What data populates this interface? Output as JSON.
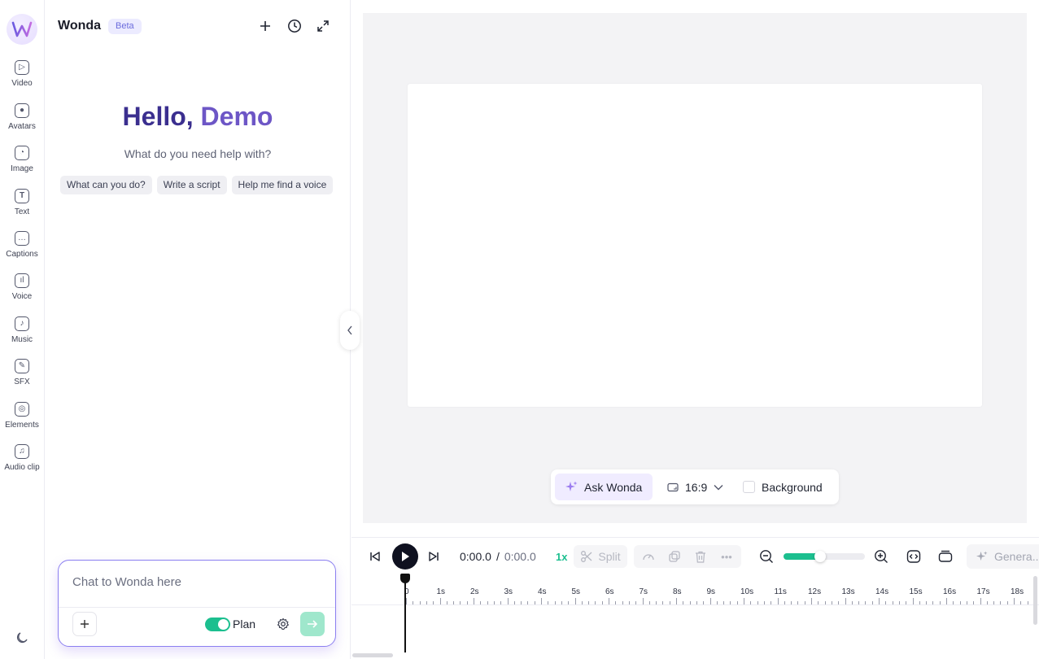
{
  "rail": {
    "items": [
      {
        "label": "Video",
        "icon": "video-icon"
      },
      {
        "label": "Avatars",
        "icon": "avatar-icon"
      },
      {
        "label": "Image",
        "icon": "image-icon"
      },
      {
        "label": "Text",
        "icon": "text-icon"
      },
      {
        "label": "Captions",
        "icon": "captions-icon"
      },
      {
        "label": "Voice",
        "icon": "voice-icon"
      },
      {
        "label": "Music",
        "icon": "music-icon"
      },
      {
        "label": "SFX",
        "icon": "sfx-icon"
      },
      {
        "label": "Elements",
        "icon": "elements-icon"
      },
      {
        "label": "Audio clip",
        "icon": "audio-clip-icon"
      }
    ]
  },
  "chat": {
    "brand": "Wonda",
    "badge": "Beta",
    "greeting": "Hello,",
    "name": "Demo",
    "question": "What do you need help with?",
    "suggestions": [
      "What can you do?",
      "Write a script",
      "Help me find a voice"
    ],
    "input_placeholder": "Chat to Wonda here",
    "plan_label": "Plan",
    "plan_enabled": true
  },
  "preview": {
    "ask_label": "Ask Wonda",
    "aspect_ratio": "16:9",
    "background_label": "Background"
  },
  "timeline": {
    "current_time": "0:00.0",
    "separator": "/",
    "duration": "0:00.0",
    "speed": "1x",
    "split_label": "Split",
    "zoom_level": 0.45,
    "generate_label": "Genera...",
    "ruler_labels": [
      "0",
      "1s",
      "2s",
      "3s",
      "4s",
      "5s",
      "6s",
      "7s",
      "8s",
      "9s",
      "10s",
      "11s",
      "12s",
      "13s",
      "14s",
      "15s",
      "16s",
      "17s",
      "18s"
    ]
  },
  "colors": {
    "accent": "#1cbf8f",
    "brand_purple": "#6d56c6",
    "greeting_dark": "#3b2f8f"
  }
}
